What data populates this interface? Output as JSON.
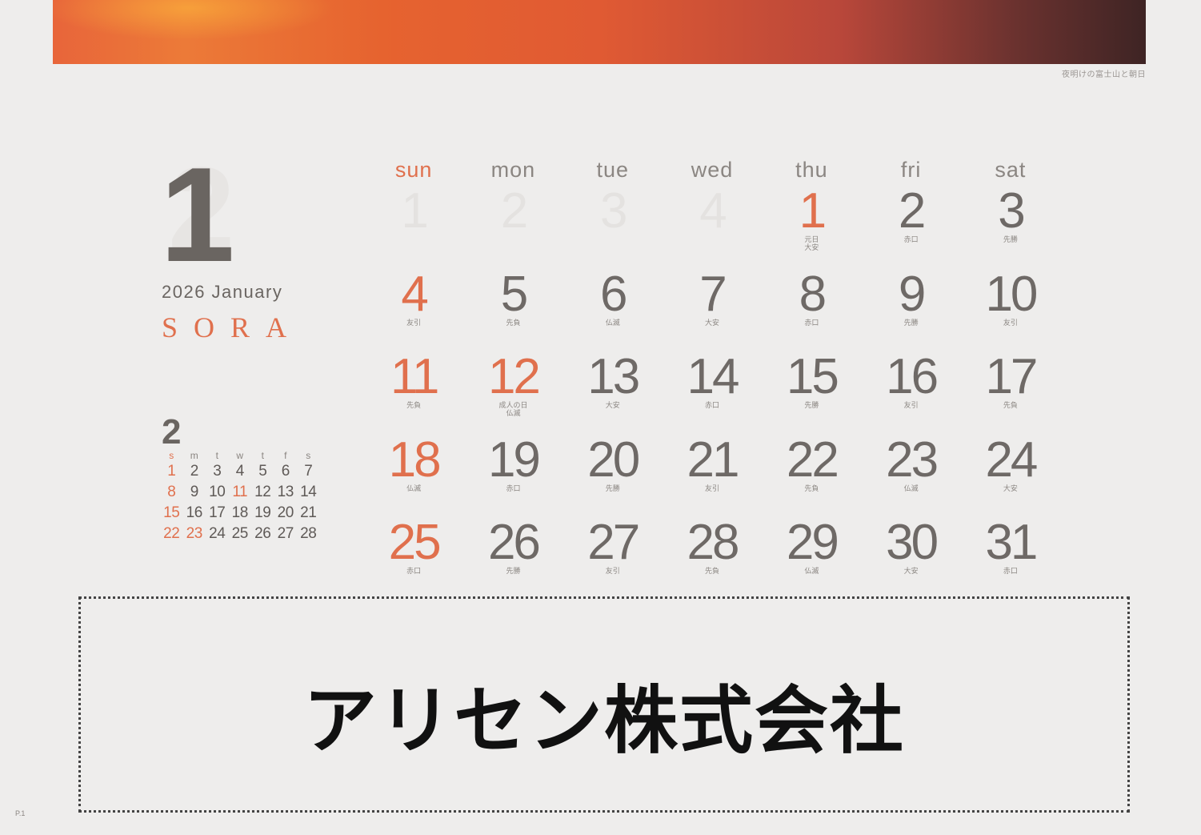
{
  "caption": "夜明けの富士山と朝日",
  "colors": {
    "accent": "#e0704d",
    "text": "#6e6966",
    "background": "#eeedec"
  },
  "month": {
    "number": "1",
    "ghost_number": "2",
    "year_month": "2026 January",
    "brand": "SORA"
  },
  "weekdays": [
    "sun",
    "mon",
    "tue",
    "wed",
    "thu",
    "fri",
    "sat"
  ],
  "days": [
    {
      "num": "1",
      "note": "",
      "ghost": true
    },
    {
      "num": "2",
      "note": "",
      "ghost": true
    },
    {
      "num": "3",
      "note": "",
      "ghost": true
    },
    {
      "num": "4",
      "note": "",
      "ghost": true
    },
    {
      "num": "1",
      "note": "元日\n大安",
      "red": true
    },
    {
      "num": "2",
      "note": "赤口"
    },
    {
      "num": "3",
      "note": "先勝"
    },
    {
      "num": "4",
      "note": "友引",
      "red": true
    },
    {
      "num": "5",
      "note": "先負"
    },
    {
      "num": "6",
      "note": "仏滅"
    },
    {
      "num": "7",
      "note": "大安"
    },
    {
      "num": "8",
      "note": "赤口"
    },
    {
      "num": "9",
      "note": "先勝"
    },
    {
      "num": "10",
      "note": "友引"
    },
    {
      "num": "11",
      "note": "先負",
      "red": true
    },
    {
      "num": "12",
      "note": "成人の日\n仏滅",
      "red": true
    },
    {
      "num": "13",
      "note": "大安"
    },
    {
      "num": "14",
      "note": "赤口"
    },
    {
      "num": "15",
      "note": "先勝"
    },
    {
      "num": "16",
      "note": "友引"
    },
    {
      "num": "17",
      "note": "先負"
    },
    {
      "num": "18",
      "note": "仏滅",
      "red": true
    },
    {
      "num": "19",
      "note": "赤口"
    },
    {
      "num": "20",
      "note": "先勝"
    },
    {
      "num": "21",
      "note": "友引"
    },
    {
      "num": "22",
      "note": "先負"
    },
    {
      "num": "23",
      "note": "仏滅"
    },
    {
      "num": "24",
      "note": "大安"
    },
    {
      "num": "25",
      "note": "赤口",
      "red": true
    },
    {
      "num": "26",
      "note": "先勝"
    },
    {
      "num": "27",
      "note": "友引"
    },
    {
      "num": "28",
      "note": "先負"
    },
    {
      "num": "29",
      "note": "仏滅"
    },
    {
      "num": "30",
      "note": "大安"
    },
    {
      "num": "31",
      "note": "赤口"
    }
  ],
  "next_month": {
    "number": "2",
    "headers": [
      "s",
      "m",
      "t",
      "w",
      "t",
      "f",
      "s"
    ],
    "cells": [
      {
        "d": "1",
        "red": true
      },
      {
        "d": "2"
      },
      {
        "d": "3"
      },
      {
        "d": "4"
      },
      {
        "d": "5"
      },
      {
        "d": "6"
      },
      {
        "d": "7"
      },
      {
        "d": "8",
        "red": true
      },
      {
        "d": "9"
      },
      {
        "d": "10"
      },
      {
        "d": "11",
        "red": true
      },
      {
        "d": "12"
      },
      {
        "d": "13"
      },
      {
        "d": "14"
      },
      {
        "d": "15",
        "red": true
      },
      {
        "d": "16"
      },
      {
        "d": "17"
      },
      {
        "d": "18"
      },
      {
        "d": "19"
      },
      {
        "d": "20"
      },
      {
        "d": "21"
      },
      {
        "d": "22",
        "red": true
      },
      {
        "d": "23",
        "red": true
      },
      {
        "d": "24"
      },
      {
        "d": "25"
      },
      {
        "d": "26"
      },
      {
        "d": "27"
      },
      {
        "d": "28"
      }
    ]
  },
  "company": "アリセン株式会社",
  "page_label": "P.1"
}
